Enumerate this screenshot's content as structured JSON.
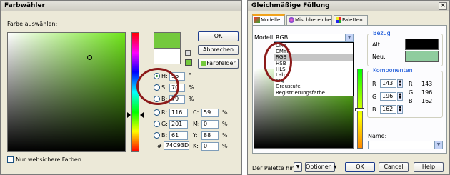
{
  "left_window": {
    "title": "Farbwähler",
    "choose_label": "Farbe auswählen:",
    "buttons": {
      "ok": "OK",
      "cancel": "Abbrechen",
      "fields": "Farbfelder"
    },
    "hsb": [
      {
        "key": "H:",
        "value": "96",
        "unit": "°"
      },
      {
        "key": "S:",
        "value": "70",
        "unit": "%"
      },
      {
        "key": "B:",
        "value": "79",
        "unit": "%"
      }
    ],
    "rgb": [
      {
        "key": "R:",
        "value": "116"
      },
      {
        "key": "G:",
        "value": "201"
      },
      {
        "key": "B:",
        "value": "61"
      }
    ],
    "cmyk": [
      {
        "key": "C:",
        "value": "59",
        "unit": "%"
      },
      {
        "key": "M:",
        "value": "0",
        "unit": "%"
      },
      {
        "key": "Y:",
        "value": "88",
        "unit": "%"
      },
      {
        "key": "K:",
        "value": "0",
        "unit": "%"
      }
    ],
    "hex_label": "#",
    "hex_value": "74C93D",
    "websafe_label": "Nur websichere Farben",
    "colors": {
      "current": "#74c93d",
      "previous": "#ffffff"
    }
  },
  "right_window": {
    "title": "Gleichmäßige Füllung",
    "close_glyph": "×",
    "tabs": [
      "Modelle",
      "Mischbereiche",
      "Paletten"
    ],
    "model_label": "Modell",
    "model_value": "RGB",
    "model_options": [
      "CMY",
      "CMYK",
      "RGB",
      "HSB",
      "HLS",
      "Lab",
      "YIQ",
      "Graustufe",
      "Registrierungsfarbe"
    ],
    "bezug": {
      "title": "Bezug",
      "old_label": "Alt:",
      "new_label": "Neu:",
      "old_color": "#000000",
      "new_color": "#8fcc9e"
    },
    "komponenten": {
      "title": "Komponenten",
      "inputs": [
        {
          "key": "R",
          "value": "143"
        },
        {
          "key": "G",
          "value": "196"
        },
        {
          "key": "B",
          "value": "162"
        }
      ],
      "readout": [
        {
          "key": "R",
          "value": "143"
        },
        {
          "key": "G",
          "value": "196"
        },
        {
          "key": "B",
          "value": "162"
        }
      ]
    },
    "name_label": "Name:",
    "add_palette": "Der Palette hinz.",
    "options": "Optionen",
    "ok": "OK",
    "cancel": "Cancel",
    "help": "Help"
  }
}
